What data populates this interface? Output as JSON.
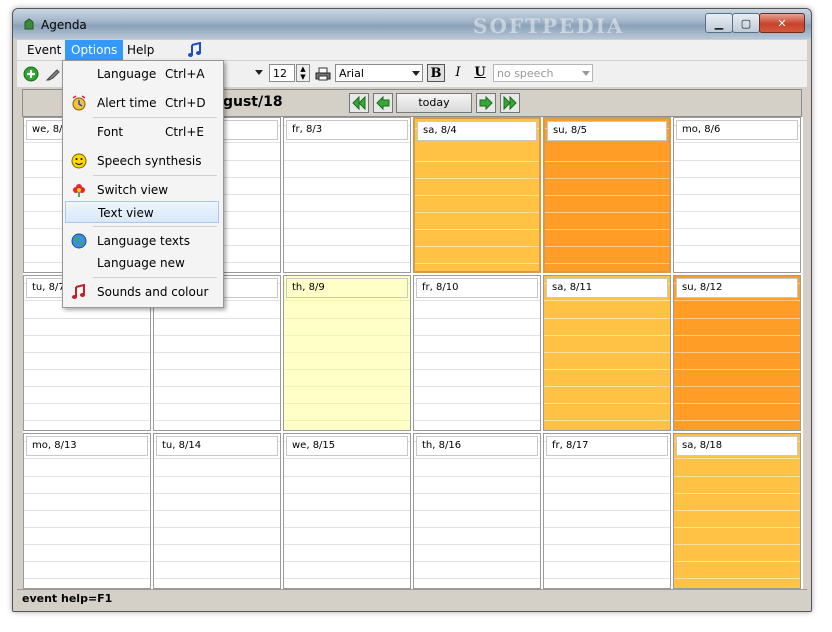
{
  "window": {
    "title": "Agenda",
    "watermark": "SOFTPEDIA"
  },
  "menubar": {
    "items": [
      "Event",
      "Options",
      "Help"
    ]
  },
  "toolbar": {
    "font_size": "12",
    "font_name": "Arial",
    "bold": "B",
    "italic": "I",
    "underline": "U",
    "speech": "no speech"
  },
  "nav": {
    "month_title": "ugust/18",
    "today_label": "today"
  },
  "calendar": {
    "row1": [
      "we, 8/1",
      "",
      "fr, 8/3",
      "sa, 8/4",
      "su, 8/5",
      "mo, 8/6"
    ],
    "row2": [
      "tu, 8/7",
      "",
      "th, 8/9",
      "fr, 8/10",
      "sa, 8/11",
      "su, 8/12"
    ],
    "row3": [
      "mo, 8/13",
      "tu, 8/14",
      "we, 8/15",
      "th, 8/16",
      "fr, 8/17",
      "sa, 8/18"
    ]
  },
  "options_menu": {
    "items": [
      {
        "label": "Language",
        "shortcut": "Ctrl+A"
      },
      {
        "label": "Alert time",
        "shortcut": "Ctrl+D"
      },
      {
        "label": "Font",
        "shortcut": "Ctrl+E"
      },
      {
        "label": "Speech synthesis",
        "shortcut": ""
      },
      {
        "label": "Switch view",
        "shortcut": ""
      },
      {
        "label": "Text view",
        "shortcut": ""
      },
      {
        "label": "Language texts",
        "shortcut": ""
      },
      {
        "label": "Language new",
        "shortcut": ""
      },
      {
        "label": "Sounds and colour",
        "shortcut": ""
      }
    ]
  },
  "status": {
    "text": "event help=F1"
  },
  "colors": {
    "saturday": "#ffc244",
    "sunday": "#ff9d27",
    "today": "#ffffc8",
    "menu_highlight": "#3399ff"
  }
}
